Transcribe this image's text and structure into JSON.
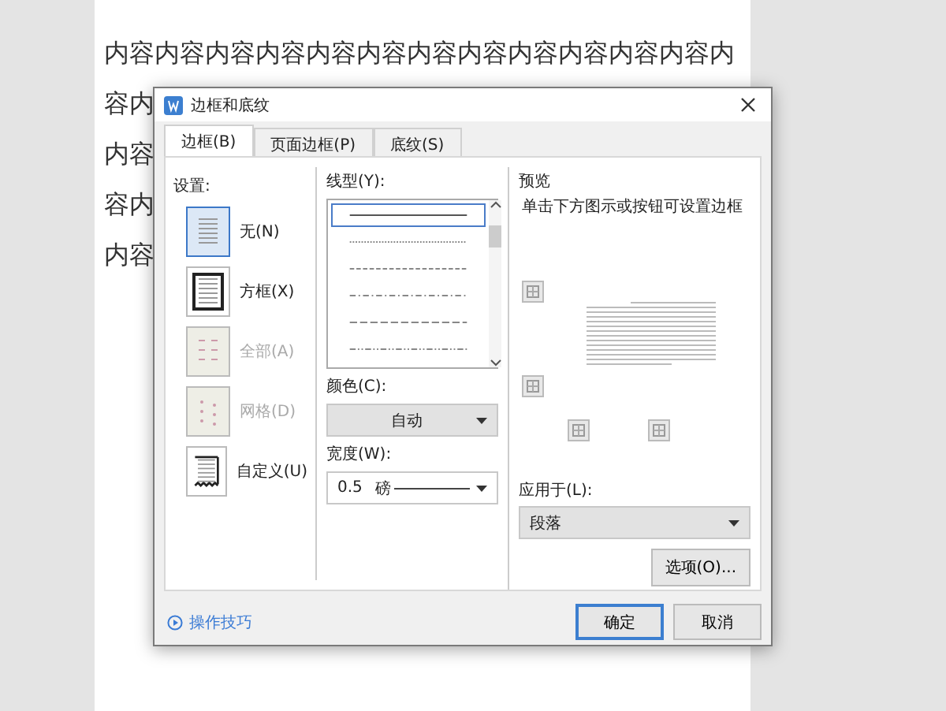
{
  "document": {
    "lines": [
      "内容内容内容内容内容内容内容内容内容内容内容内容内",
      "容内",
      "内容",
      "容内",
      "内容"
    ]
  },
  "dialog": {
    "title": "边框和底纹",
    "tabs": [
      {
        "label": "边框(B)",
        "selected": true
      },
      {
        "label": "页面边框(P)",
        "selected": false
      },
      {
        "label": "底纹(S)",
        "selected": false
      }
    ],
    "settings": {
      "label": "设置:",
      "items": [
        {
          "label": "无(N)",
          "kind": "none",
          "selected": true,
          "disabled": false
        },
        {
          "label": "方框(X)",
          "kind": "box",
          "selected": false,
          "disabled": false
        },
        {
          "label": "全部(A)",
          "kind": "all",
          "selected": false,
          "disabled": true
        },
        {
          "label": "网格(D)",
          "kind": "grid",
          "selected": false,
          "disabled": true
        },
        {
          "label": "自定义(U)",
          "kind": "custom",
          "selected": false,
          "disabled": false
        }
      ]
    },
    "line_style": {
      "label": "线型(Y):",
      "styles": [
        {
          "kind": "solid",
          "selected": true
        },
        {
          "kind": "dotted",
          "selected": false
        },
        {
          "kind": "dashed",
          "selected": false
        },
        {
          "kind": "dash-dot",
          "selected": false
        },
        {
          "kind": "long-dash",
          "selected": false
        },
        {
          "kind": "dash-dot-dot",
          "selected": false
        }
      ]
    },
    "color": {
      "label": "颜色(C):",
      "value": "自动"
    },
    "width": {
      "label": "宽度(W):",
      "value": "0.5",
      "unit": "磅"
    },
    "preview": {
      "label": "预览",
      "hint": "单击下方图示或按钮可设置边框"
    },
    "apply_to": {
      "label": "应用于(L):",
      "value": "段落"
    },
    "options_button": "选项(O)...",
    "tips_link": "操作技巧",
    "ok_button": "确定",
    "cancel_button": "取消"
  }
}
